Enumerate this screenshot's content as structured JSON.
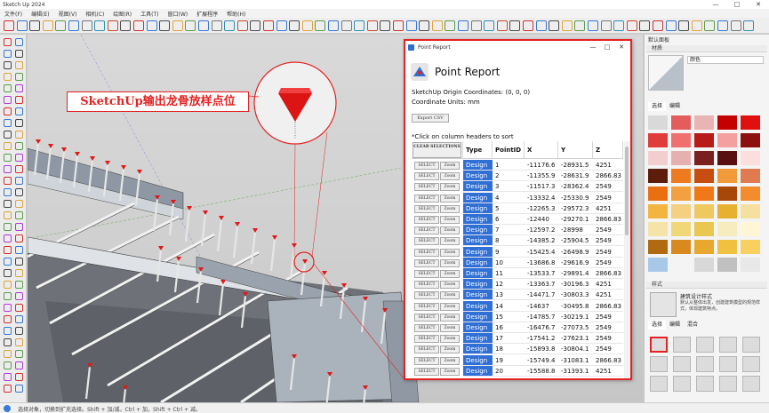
{
  "window": {
    "title": "Sketch Up 2024",
    "minimize": "—",
    "maximize": "□",
    "close": "✕"
  },
  "menu": [
    "文件(F)",
    "编辑(E)",
    "视图(V)",
    "相机(C)",
    "绘图(R)",
    "工具(T)",
    "窗口(W)",
    "扩展程序",
    "帮助(H)"
  ],
  "callout": {
    "label": "SketchUp输出龙骨放样点位"
  },
  "dialog": {
    "title": "Point Report",
    "heading": "Point Report",
    "origin": "SketchUp Origin Coordinates: (0, 0, 0)",
    "units": "Coordinate Units: mm",
    "export_label": "Export CSV",
    "sort_hint": "*Click on column headers to sort",
    "clear_label": "CLEAR SELECTIONS",
    "select_label": "SELECT",
    "zoom_label": "Zoom",
    "columns": {
      "type": "Type",
      "id": "PointID",
      "x": "X",
      "y": "Y",
      "z": "Z"
    },
    "rows": [
      {
        "type": "Design",
        "id": "1",
        "x": "-11176.6",
        "y": "-28931.5",
        "z": "4251"
      },
      {
        "type": "Design",
        "id": "2",
        "x": "-11355.9",
        "y": "-28631.9",
        "z": "2866.83"
      },
      {
        "type": "Design",
        "id": "3",
        "x": "-11517.3",
        "y": "-28362.4",
        "z": "2549"
      },
      {
        "type": "Design",
        "id": "4",
        "x": "-13332.4",
        "y": "-25330.9",
        "z": "2549"
      },
      {
        "type": "Design",
        "id": "5",
        "x": "-12265.3",
        "y": "-29572.3",
        "z": "4251"
      },
      {
        "type": "Design",
        "id": "6",
        "x": "-12440",
        "y": "-29270.1",
        "z": "2866.83"
      },
      {
        "type": "Design",
        "id": "7",
        "x": "-12597.2",
        "y": "-28998",
        "z": "2549"
      },
      {
        "type": "Design",
        "id": "8",
        "x": "-14385.2",
        "y": "-25904.5",
        "z": "2549"
      },
      {
        "type": "Design",
        "id": "9",
        "x": "-15425.4",
        "y": "-26498.9",
        "z": "2549"
      },
      {
        "type": "Design",
        "id": "10",
        "x": "-13686.8",
        "y": "-29616.9",
        "z": "2549"
      },
      {
        "type": "Design",
        "id": "11",
        "x": "-13533.7",
        "y": "-29891.4",
        "z": "2866.83"
      },
      {
        "type": "Design",
        "id": "12",
        "x": "-13363.7",
        "y": "-30196.3",
        "z": "4251"
      },
      {
        "type": "Design",
        "id": "13",
        "x": "-14471.7",
        "y": "-30803.3",
        "z": "4251"
      },
      {
        "type": "Design",
        "id": "14",
        "x": "-14637",
        "y": "-30495.8",
        "z": "2866.83"
      },
      {
        "type": "Design",
        "id": "15",
        "x": "-14785.7",
        "y": "-30219.1",
        "z": "2549"
      },
      {
        "type": "Design",
        "id": "16",
        "x": "-16476.7",
        "y": "-27073.5",
        "z": "2549"
      },
      {
        "type": "Design",
        "id": "17",
        "x": "-17541.2",
        "y": "-27623.1",
        "z": "2549"
      },
      {
        "type": "Design",
        "id": "18",
        "x": "-15893.8",
        "y": "-30804.1",
        "z": "2549"
      },
      {
        "type": "Design",
        "id": "19",
        "x": "-15749.4",
        "y": "-31083.1",
        "z": "2866.83"
      },
      {
        "type": "Design",
        "id": "20",
        "x": "-15588.8",
        "y": "-31393.1",
        "z": "4251"
      }
    ]
  },
  "tray": {
    "title": "默认面板",
    "materials_header": "材质",
    "materials_name": "颜色",
    "styles_header": "样式",
    "styles_name": "建筑设计样式",
    "styles_desc": "默认从整体出发，创建建筑模型的规范样式，体现建筑特点。",
    "tabs": [
      "选择",
      "编辑",
      "混合"
    ]
  },
  "status": {
    "text": "选择对象，切换到扩充选择。Shift + 加/减，Ctrl + 加，Shift + Ctrl + 减。"
  },
  "colors": {
    "accent": "#e52222",
    "type_cell": "#2f6fd6"
  }
}
